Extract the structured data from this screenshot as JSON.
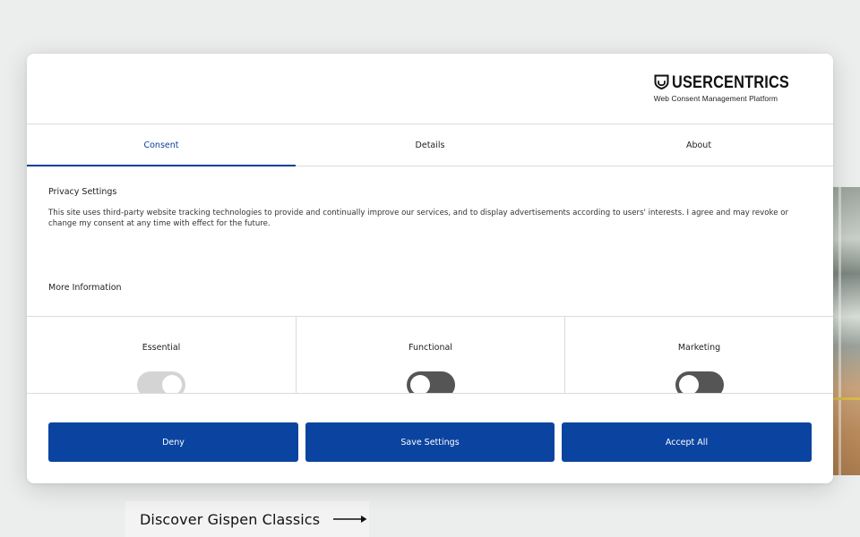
{
  "background": {
    "discover_label": "Discover Gispen Classics"
  },
  "header": {
    "logo_text": "USERCENTRICS",
    "logo_subtitle": "Web Consent Management Platform"
  },
  "tabs": [
    {
      "label": "Consent",
      "active": true
    },
    {
      "label": "Details",
      "active": false
    },
    {
      "label": "About",
      "active": false
    }
  ],
  "consent": {
    "title": "Privacy Settings",
    "description": "This site uses third-party website tracking technologies to provide and continually improve our services, and to display advertisements according to users' interests. I agree and may revoke or change my consent at any time with effect for the future.",
    "more_info": "More Information"
  },
  "categories": [
    {
      "label": "Essential",
      "enabled": true,
      "locked": true
    },
    {
      "label": "Functional",
      "enabled": false
    },
    {
      "label": "Marketing",
      "enabled": false
    }
  ],
  "buttons": {
    "deny": "Deny",
    "save": "Save Settings",
    "accept": "Accept All"
  },
  "colors": {
    "primary": "#0b44a0",
    "active_tab": "#0b3e99",
    "toggle_off": "#555555",
    "toggle_locked_on": "#d4d4d4"
  },
  "icons": {
    "logo": "usercentrics-shield-icon",
    "discover_arrow": "long-right-arrow-icon"
  }
}
